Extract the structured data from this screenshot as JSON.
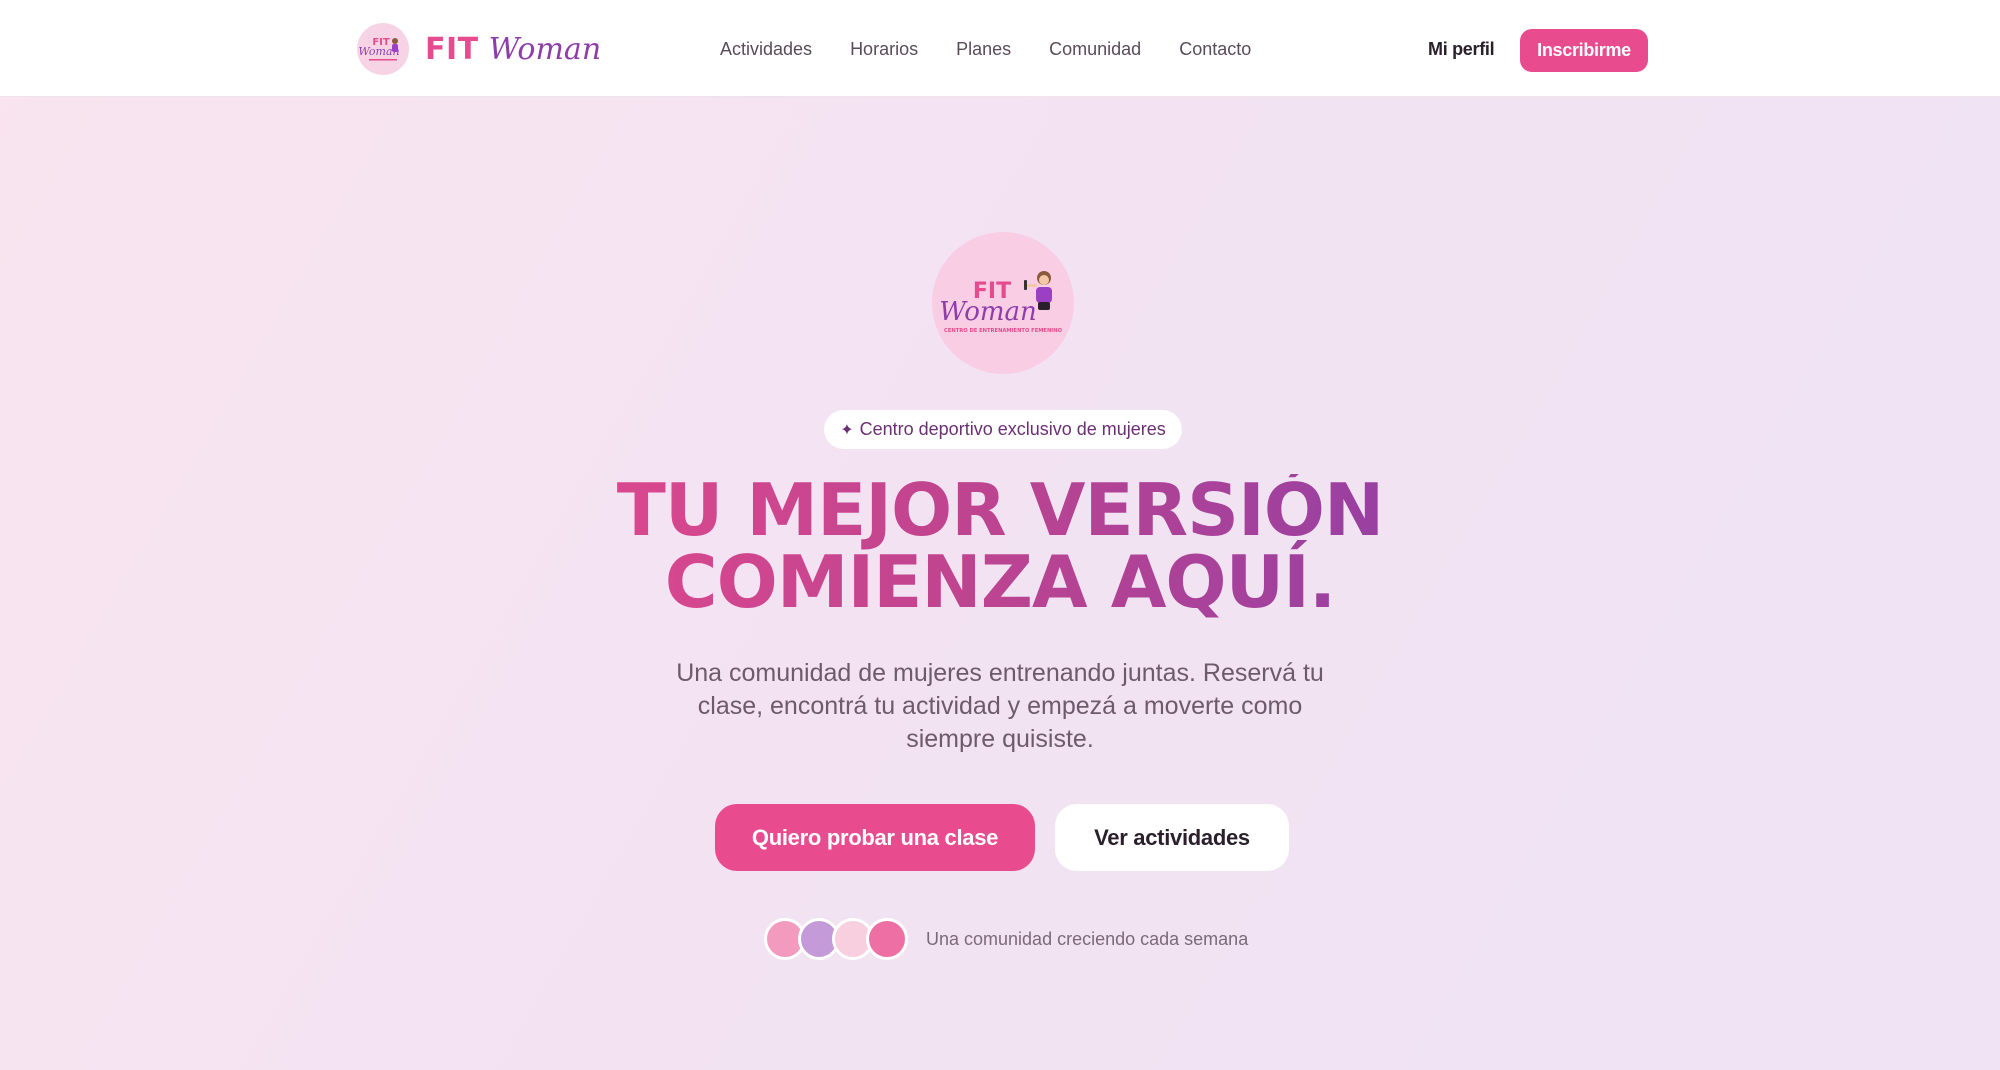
{
  "brand": {
    "name_fit": "FIT",
    "name_woman": "Woman",
    "logo_icon": "fit-woman-logo"
  },
  "nav": {
    "links": [
      "Actividades",
      "Horarios",
      "Planes",
      "Comunidad",
      "Contacto"
    ],
    "profile_label": "Mi perfil",
    "signup_label": "Inscribirme"
  },
  "hero": {
    "logo_lettering": {
      "fit": "FIT",
      "woman": "Woman",
      "tagline": "CENTRO DE ENTRENAMIENTO FEMENINO"
    },
    "pill_icon": "✦",
    "pill_text": "Centro deportivo exclusivo de mujeres",
    "headline_line1": "TU MEJOR VERSIÓN",
    "headline_line2": "COMIENZA AQUÍ.",
    "subtitle": "Una comunidad de mujeres entrenando juntas. Reservá tu clase, encontrá tu actividad y empezá a moverte como siempre quisiste.",
    "cta_primary": "Quiero probar una clase",
    "cta_secondary": "Ver actividades",
    "community_text": "Una comunidad creciendo cada semana",
    "avatar_colors": [
      "#f29bbf",
      "#c49ad9",
      "#f7cfdf",
      "#ee6fa3"
    ]
  },
  "colors": {
    "accent": "#e94b8f",
    "purple": "#8e3fa6",
    "background": "#f5e4f0"
  }
}
